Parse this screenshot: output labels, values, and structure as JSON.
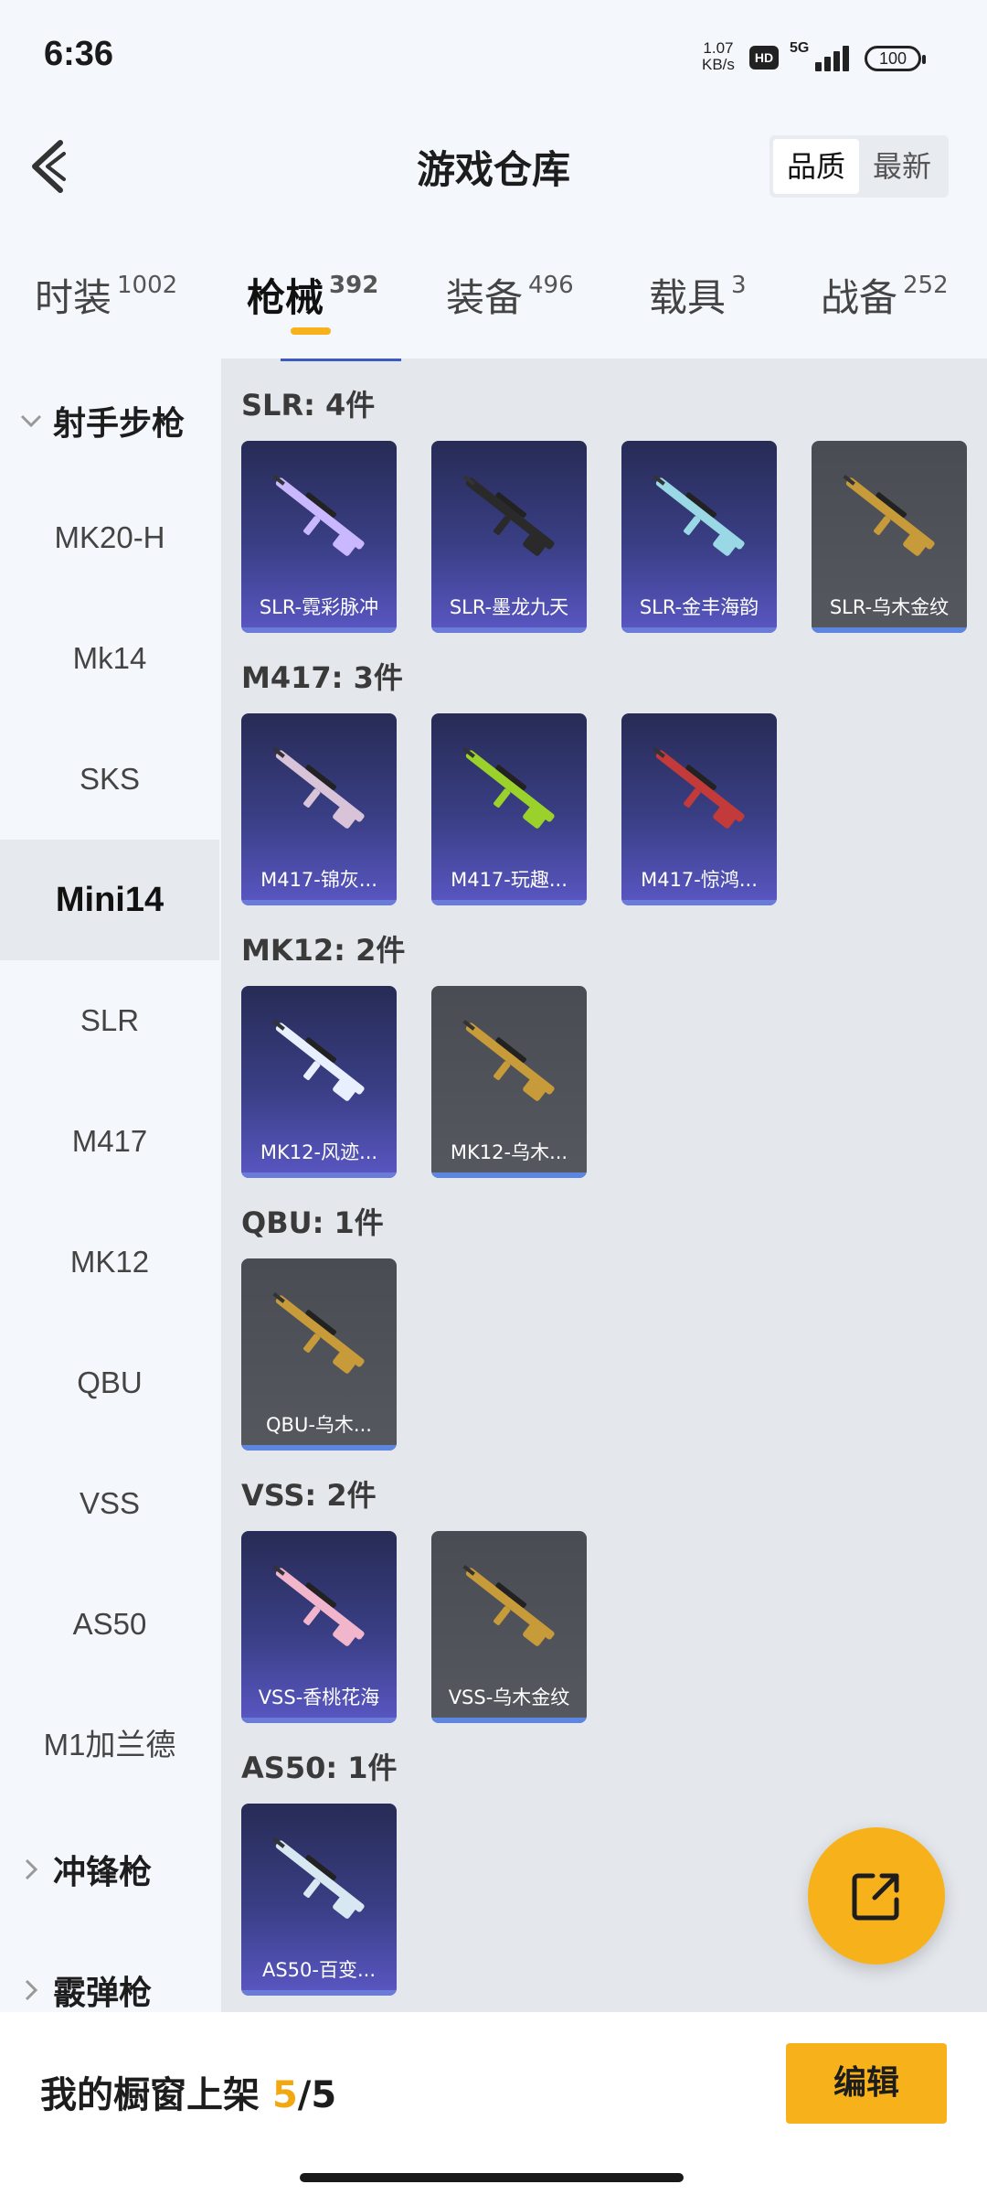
{
  "status_bar": {
    "time": "6:36",
    "net_speed": "1.07",
    "net_unit": "KB/s",
    "hd": "HD",
    "network": "5G",
    "battery": "100"
  },
  "header": {
    "title": "游戏仓库",
    "sort_options": [
      "品质",
      "最新"
    ],
    "active_sort": "品质"
  },
  "tabs": [
    {
      "label": "时装",
      "count": "1002"
    },
    {
      "label": "枪械",
      "count": "392"
    },
    {
      "label": "装备",
      "count": "496"
    },
    {
      "label": "载具",
      "count": "3"
    },
    {
      "label": "战备",
      "count": "252"
    }
  ],
  "sidebar": {
    "group_open": "射手步枪",
    "items": [
      "MK20-H",
      "Mk14",
      "SKS",
      "Mini14",
      "SLR",
      "M417",
      "MK12",
      "QBU",
      "VSS",
      "AS50",
      "M1加兰德"
    ],
    "active": "Mini14",
    "group_2": "冲锋枪",
    "group_3": "霰弹枪"
  },
  "sections": [
    {
      "title": "SLR: 4件",
      "cards": [
        {
          "name": "SLR-霓彩脉冲",
          "style": "purple",
          "color": "#c9b8ff"
        },
        {
          "name": "SLR-墨龙九天",
          "style": "purple",
          "color": "#2a2a2a"
        },
        {
          "name": "SLR-金丰海韵",
          "style": "purple",
          "color": "#9ad8e6"
        },
        {
          "name": "SLR-乌木金纹",
          "style": "grey",
          "color": "#c79a3a"
        }
      ]
    },
    {
      "title": "M417: 3件",
      "cards": [
        {
          "name": "M417-锦灰...",
          "style": "purple",
          "color": "#d8c3d8"
        },
        {
          "name": "M417-玩趣...",
          "style": "purple",
          "color": "#9ad12a"
        },
        {
          "name": "M417-惊鸿...",
          "style": "purple",
          "color": "#c23a3a"
        }
      ]
    },
    {
      "title": "MK12: 2件",
      "cards": [
        {
          "name": "MK12-风迹...",
          "style": "purple",
          "color": "#e8f0ff"
        },
        {
          "name": "MK12-乌木...",
          "style": "grey",
          "color": "#c79a3a"
        }
      ]
    },
    {
      "title": "QBU: 1件",
      "cards": [
        {
          "name": "QBU-乌木...",
          "style": "grey",
          "color": "#c79a3a"
        }
      ]
    },
    {
      "title": "VSS: 2件",
      "cards": [
        {
          "name": "VSS-香桃花海",
          "style": "purple",
          "color": "#f2b6cc"
        },
        {
          "name": "VSS-乌木金纹",
          "style": "grey",
          "color": "#c79a3a"
        }
      ]
    },
    {
      "title": "AS50: 1件",
      "cards": [
        {
          "name": "AS50-百变...",
          "style": "purple",
          "color": "#d7e8f2"
        }
      ]
    }
  ],
  "bottom": {
    "shelf_label": "我的橱窗上架",
    "shelf_current": "5",
    "shelf_sep": "/",
    "shelf_total": "5",
    "edit_label": "编辑"
  },
  "colors": {
    "accent": "#f7b21b",
    "card_purple": "#3a3f86",
    "card_grey": "#4a4c53"
  }
}
